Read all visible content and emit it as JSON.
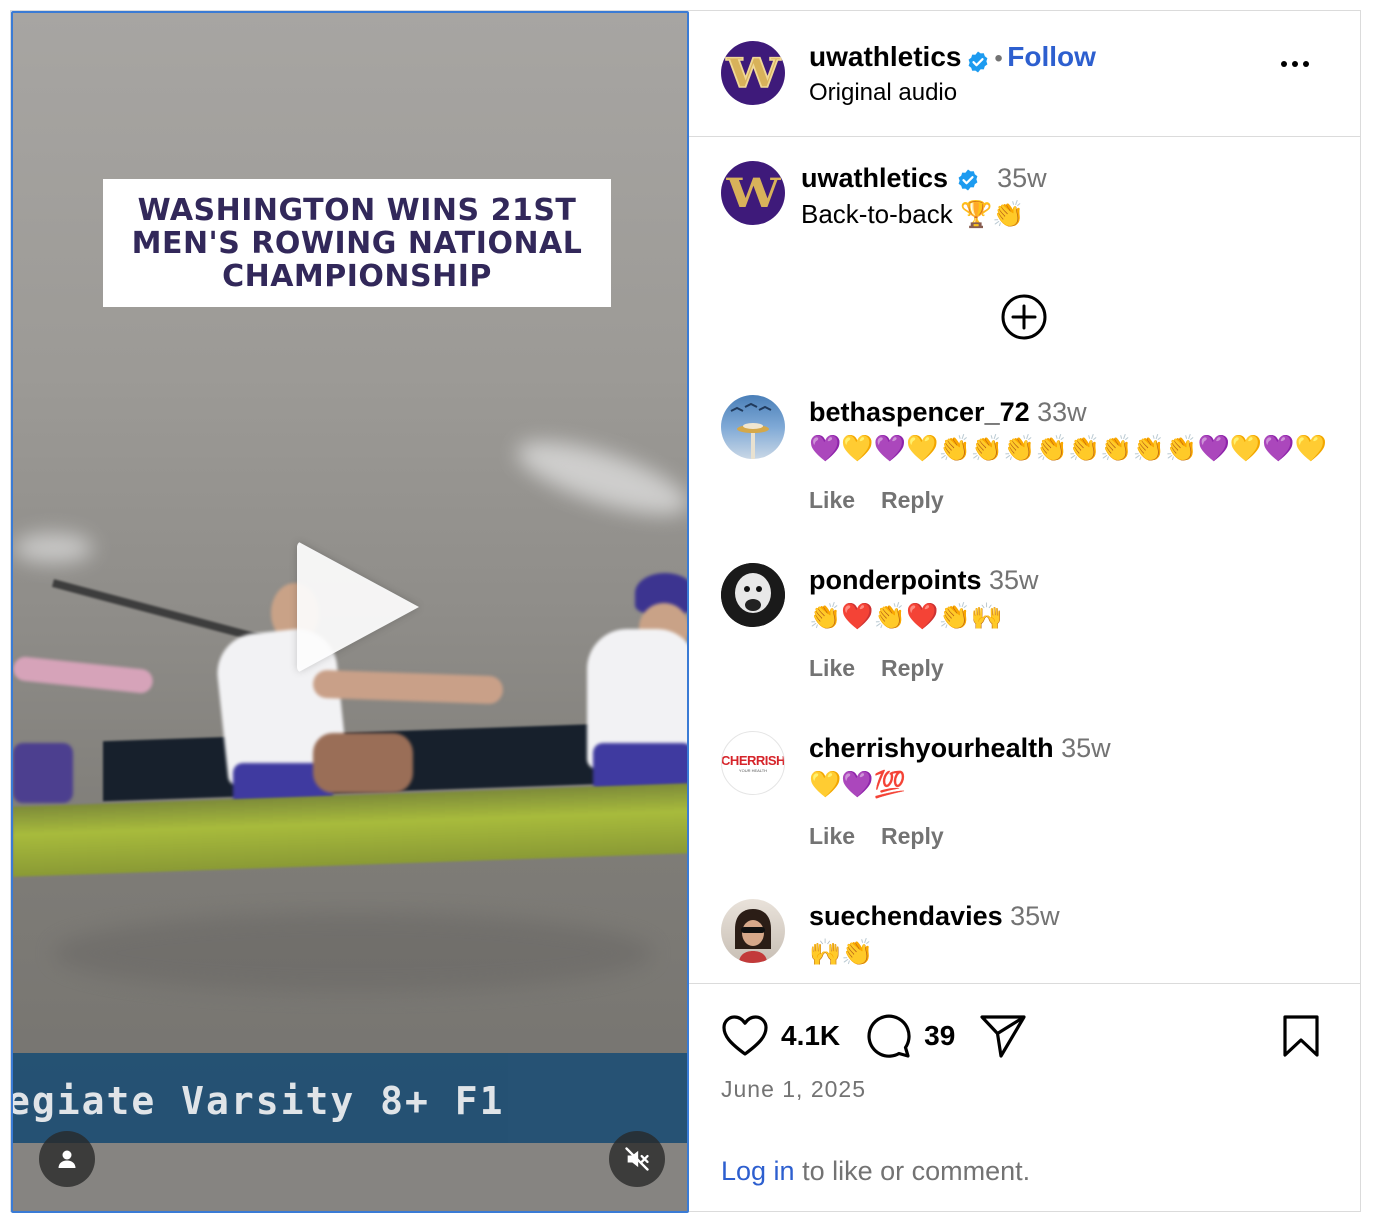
{
  "video": {
    "banner_text": "WASHINGTON WINS 21ST\nMEN'S ROWING NATIONAL\nCHAMPIONSHIP",
    "lower_third": "egiate Varsity 8+ F1",
    "controls": {
      "play_icon": "play-icon",
      "user_icon": "person-icon",
      "mute_icon": "muted-speaker-icon"
    }
  },
  "header": {
    "username": "uwathletics",
    "separator": "•",
    "follow_label": "Follow",
    "audio_label": "Original audio",
    "avatar_letter": "W"
  },
  "caption": {
    "username": "uwathletics",
    "time": "35w",
    "text": "Back-to-back 🏆👏"
  },
  "comments": [
    {
      "username": "bethaspencer_72",
      "time": "33w",
      "text": "💜💛💜💛👏👏👏👏👏👏👏👏💜💛💜💛",
      "like": "Like",
      "reply": "Reply"
    },
    {
      "username": "ponderpoints",
      "time": "35w",
      "text": "👏❤️👏❤️👏🙌",
      "like": "Like",
      "reply": "Reply"
    },
    {
      "username": "cherrishyourhealth",
      "time": "35w",
      "text": "💛💜💯",
      "like": "Like",
      "reply": "Reply",
      "avatar_text": "CHERRISH",
      "avatar_subtext": "YOUR HEALTH"
    },
    {
      "username": "suechendavies",
      "time": "35w",
      "text": "🙌👏"
    }
  ],
  "actions": {
    "likes": "4.1K",
    "comments": "39",
    "date": "June 1, 2025",
    "login_link": "Log in",
    "login_rest": " to like or comment."
  },
  "colors": {
    "link": "#2d5fcf",
    "muted": "#737373",
    "uw_purple": "#3e1a7a",
    "uw_gold": "#d8b25a",
    "verified": "#1d9bf0"
  }
}
